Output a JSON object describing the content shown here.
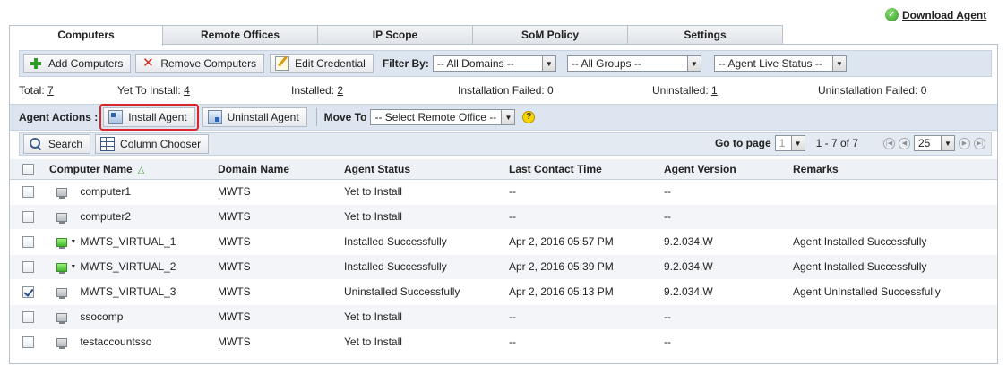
{
  "download_agent": "Download Agent",
  "tabs": [
    "Computers",
    "Remote Offices",
    "IP Scope",
    "SoM Policy",
    "Settings"
  ],
  "toolbar": {
    "add": "Add Computers",
    "remove": "Remove Computers",
    "edit": "Edit Credential",
    "filter_label": "Filter By:",
    "domains": "-- All Domains --",
    "groups": "-- All Groups --",
    "live_status": "-- Agent Live Status --"
  },
  "stats": {
    "total_label": "Total:",
    "total": "7",
    "yet_label": "Yet To Install:",
    "yet": "4",
    "installed_label": "Installed:",
    "installed": "2",
    "install_failed": "Installation Failed: 0",
    "uninstalled_label": "Uninstalled:",
    "uninstalled": "1",
    "uninstall_failed": "Uninstallation Failed: 0"
  },
  "actions": {
    "label": "Agent Actions :",
    "install": "Install Agent",
    "uninstall": "Uninstall Agent",
    "move_label": "Move To",
    "remote_office": "-- Select Remote Office --"
  },
  "search": {
    "search": "Search",
    "column_chooser": "Column Chooser"
  },
  "pager": {
    "go_to": "Go to page",
    "page": "1",
    "range": "1 - 7 of 7",
    "per_page": "25"
  },
  "columns": [
    "Computer Name",
    "Domain Name",
    "Agent Status",
    "Last Contact Time",
    "Agent Version",
    "Remarks"
  ],
  "rows": [
    {
      "checked": false,
      "icon": "gray",
      "name": "computer1",
      "domain": "MWTS",
      "status": "Yet to Install",
      "time": "--",
      "version": "--",
      "remarks": ""
    },
    {
      "checked": false,
      "icon": "gray",
      "name": "computer2",
      "domain": "MWTS",
      "status": "Yet to Install",
      "time": "--",
      "version": "--",
      "remarks": ""
    },
    {
      "checked": false,
      "icon": "green",
      "name": "MWTS_VIRTUAL_1",
      "domain": "MWTS",
      "status": "Installed Successfully",
      "time": "Apr 2, 2016 05:57 PM",
      "version": "9.2.034.W",
      "remarks": "Agent Installed Successfully"
    },
    {
      "checked": false,
      "icon": "green",
      "name": "MWTS_VIRTUAL_2",
      "domain": "MWTS",
      "status": "Installed Successfully",
      "time": "Apr 2, 2016 05:39 PM",
      "version": "9.2.034.W",
      "remarks": "Agent Installed Successfully"
    },
    {
      "checked": true,
      "icon": "gray",
      "name": "MWTS_VIRTUAL_3",
      "domain": "MWTS",
      "status": "Uninstalled Successfully",
      "time": "Apr 2, 2016 05:13 PM",
      "version": "9.2.034.W",
      "remarks": "Agent UnInstalled Successfully"
    },
    {
      "checked": false,
      "icon": "gray",
      "name": "ssocomp",
      "domain": "MWTS",
      "status": "Yet to Install",
      "time": "--",
      "version": "--",
      "remarks": ""
    },
    {
      "checked": false,
      "icon": "gray",
      "name": "testaccountsso",
      "domain": "MWTS",
      "status": "Yet to Install",
      "time": "--",
      "version": "--",
      "remarks": ""
    }
  ]
}
